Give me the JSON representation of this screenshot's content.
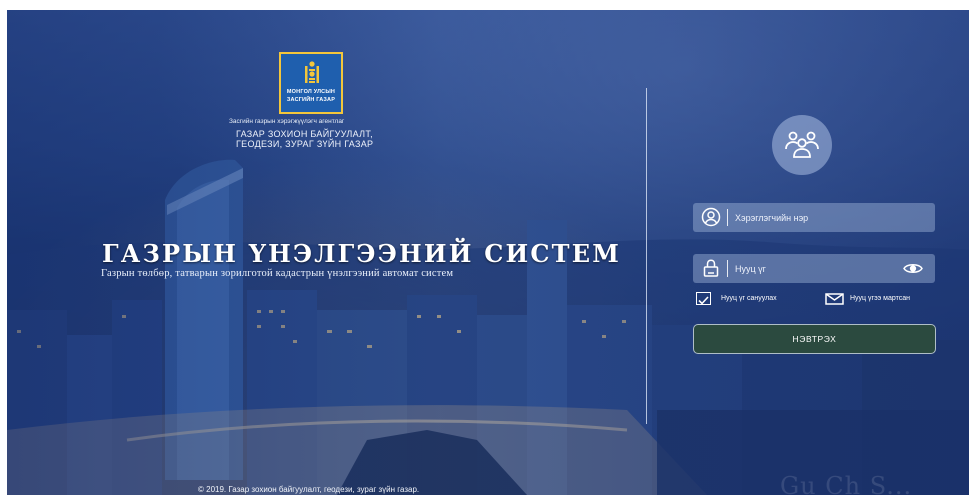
{
  "emblem": {
    "line1": "МОНГОЛ УЛСЫН",
    "line2": "ЗАСГИЙН ГАЗАР"
  },
  "agency": {
    "small": "Засгийн газрын хэрэгжүүлэгч агентлаг",
    "name_line1": "ГАЗАР ЗОХИОН  БАЙГУУЛАЛТ,",
    "name_line2": "ГЕОДЕЗИ, ЗУРАГ ЗҮЙН ГАЗАР"
  },
  "system": {
    "title": "ГАЗРЫН  ҮНЭЛГЭЭНИЙ  СИСТЕМ",
    "subtitle": "Газрын төлбөр, татварын зорилготой кадастрын үнэлгээний автомат систем"
  },
  "login": {
    "username_placeholder": "Хэрэглэгчийн нэр",
    "password_placeholder": "Нууц үг",
    "remember_label": "Нууц үг сануулах",
    "forgot_label": "Нууц үгээ мартсан",
    "submit_label": "НЭВТРЭХ"
  },
  "footer": {
    "copyright": "© 2019. Газар зохион байгуулалт,  геодези, зураг зүйн газар."
  },
  "watermark": {
    "text": "Gu Ch S..."
  },
  "colors": {
    "emblem_bg": "#1f5fae",
    "emblem_border": "#f3c63b",
    "button_bg": "#2b4a3f",
    "scene_blue": "#2c4b8a"
  },
  "icons": [
    "soyombo-emblem-icon",
    "users-group-icon",
    "user-circle-icon",
    "lock-icon",
    "eye-icon",
    "checkbox-icon",
    "envelope-icon"
  ]
}
